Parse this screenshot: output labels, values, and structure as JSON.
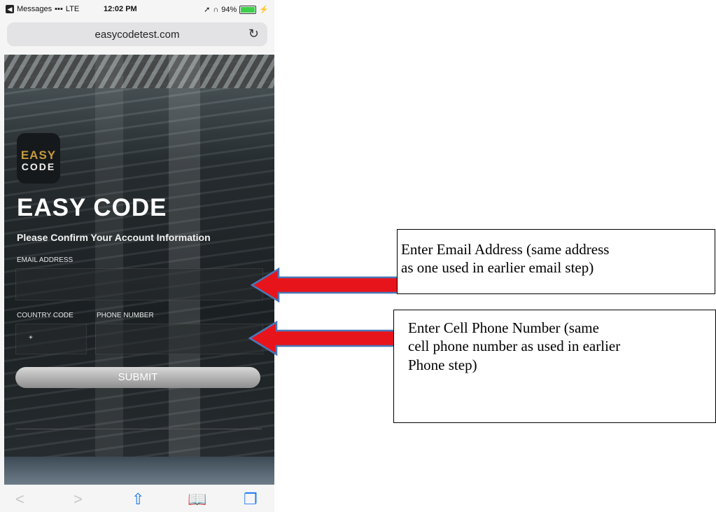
{
  "status_bar": {
    "back_app": "Messages",
    "network": "LTE",
    "time": "12:02 PM",
    "battery_text": "94%"
  },
  "browser": {
    "url": "easycodetest.com",
    "reload_icon": "reload-icon"
  },
  "logo": {
    "line1": "EASY",
    "line2": "CODE"
  },
  "app_title": "EASY CODE",
  "subtitle": "Please Confirm Your Account Information",
  "form": {
    "email_label": "EMAIL ADDRESS",
    "country_code_label": "COUNTRY CODE",
    "country_code_value": "+",
    "phone_label": "PHONE NUMBER",
    "submit_label": "SUBMIT"
  },
  "toolbar": {
    "back": "<",
    "forward": ">",
    "share_icon": "share-icon",
    "bookmarks_icon": "bookmarks-icon",
    "tabs_icon": "tabs-icon"
  },
  "callouts": {
    "email_line1": "Enter Email Address (same address",
    "email_line2": "as one used in earlier email step)",
    "phone_line1": "Enter Cell Phone Number (same",
    "phone_line2": "cell phone number as used in earlier",
    "phone_line3": "Phone step)"
  },
  "colors": {
    "arrow_red": "#e8141b",
    "arrow_blue": "#4a78b8",
    "logo_gold": "#c89a3e"
  }
}
